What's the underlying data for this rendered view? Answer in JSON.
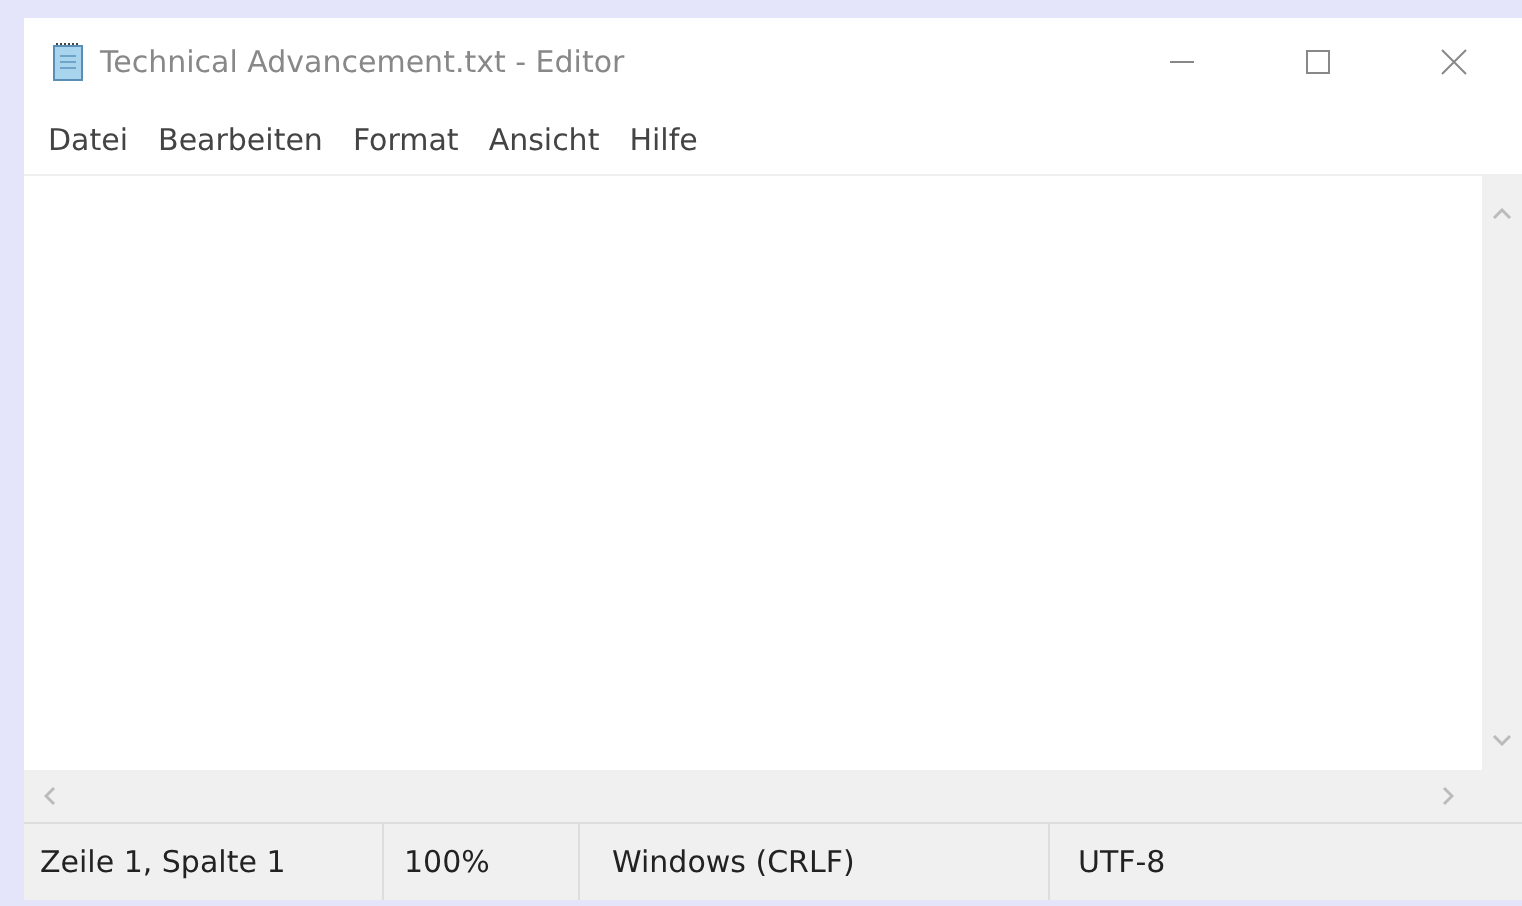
{
  "window": {
    "title": "Technical Advancement.txt - Editor"
  },
  "menu": [
    {
      "label": "Datei"
    },
    {
      "label": "Bearbeiten"
    },
    {
      "label": "Format"
    },
    {
      "label": "Ansicht"
    },
    {
      "label": "Hilfe"
    }
  ],
  "status_bar": [
    {
      "text": "Zeile 1, Spalte 1"
    },
    {
      "text": "100%"
    },
    {
      "text": "Windows (CRLF)"
    },
    {
      "text": "UTF-8"
    }
  ]
}
